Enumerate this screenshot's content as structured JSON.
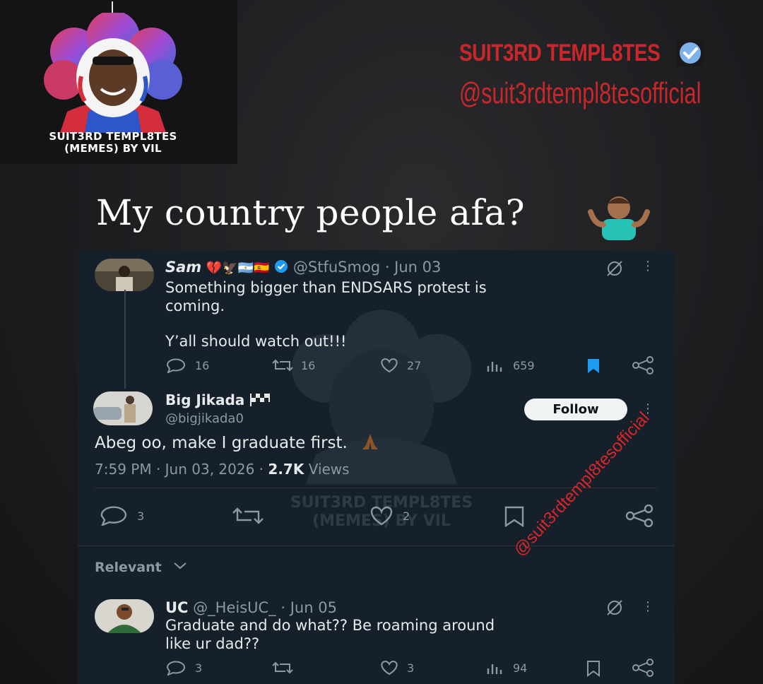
{
  "brand": {
    "logo_text_line1": "SUIT3RD TEMPL8TES",
    "logo_text_line2": "(MEMES) BY VIL",
    "name": "SUIT3RD TEMPL8TES",
    "handle": "@suit3rdtempl8tesofficial",
    "red": "#c8282b"
  },
  "headline": "My country people afa?",
  "watermark": {
    "line1": "SUIT3RD TEMPL8TES",
    "line2": "(MEMES) BY VIL",
    "diagonal": "@suit3rdtempl8tesofficial"
  },
  "quoted_tweet": {
    "name": "Sam",
    "emojis": "💔🦅🇦🇷🇪🇸",
    "handle": "@StfuSmog",
    "date": "· Jun 03",
    "text_line1": "Something bigger than ENDSARS protest is",
    "text_line2": "coming.",
    "text_line3": "Y’all should watch out!!!",
    "replies": "16",
    "retweets": "16",
    "likes": "27",
    "views": "659",
    "bookmark_color": "#1d9bf0"
  },
  "main_tweet": {
    "name": "Big Jikada",
    "handle": "@bigjikada0",
    "follow_label": "Follow",
    "text": "Abeg oo, make I graduate first.",
    "time": "7:59 PM · Jun 03, 2026 ·",
    "views_count": "2.7K",
    "views_label": "Views",
    "replies": "3",
    "likes": "2"
  },
  "sort": {
    "label": "Relevant"
  },
  "reply_tweet": {
    "name": "UC",
    "handle": "@_HeisUC_",
    "date": "· Jun 05",
    "text_line1": "Graduate and do what?? Be roaming around",
    "text_line2": "like ur dad??",
    "replies": "3",
    "likes": "3",
    "views": "94"
  }
}
